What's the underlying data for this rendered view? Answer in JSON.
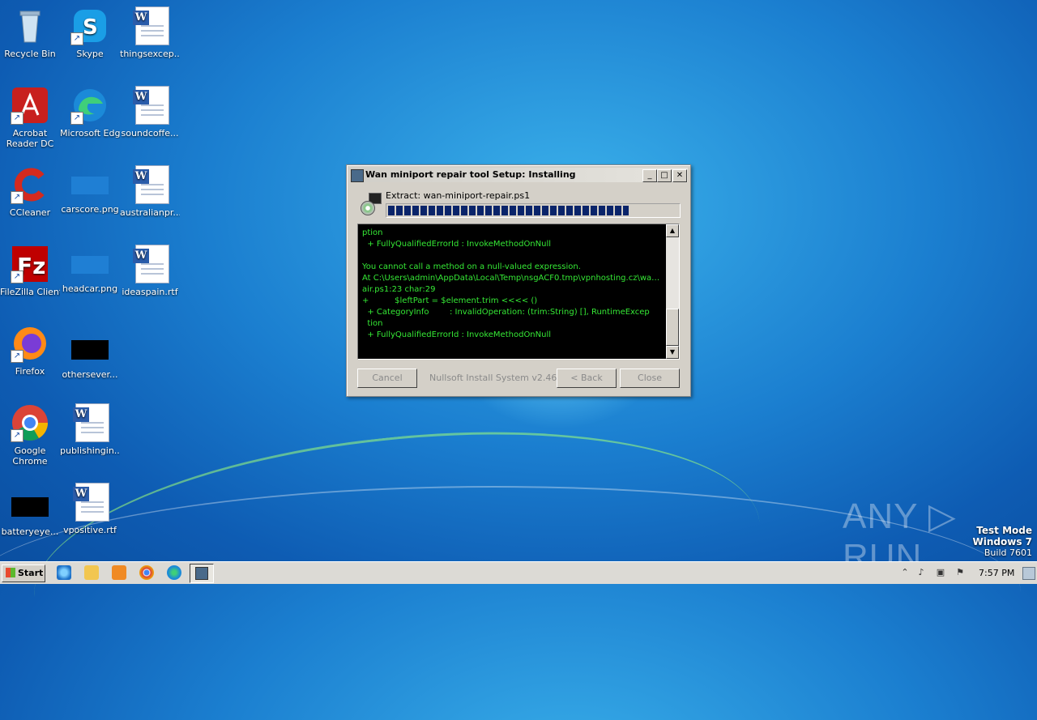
{
  "desktop": {
    "icons": [
      {
        "label": "Recycle Bin"
      },
      {
        "label": "Skype"
      },
      {
        "label": "thingsexcep..."
      },
      {
        "label": "Acrobat Reader DC"
      },
      {
        "label": "Microsoft Edge"
      },
      {
        "label": "soundcoffe..."
      },
      {
        "label": "CCleaner"
      },
      {
        "label": "carscore.png"
      },
      {
        "label": "australianpr..."
      },
      {
        "label": "FileZilla Client"
      },
      {
        "label": "headcar.png"
      },
      {
        "label": "ideaspain.rtf"
      },
      {
        "label": "Firefox"
      },
      {
        "label": "othersever..."
      },
      {
        "label": "Google Chrome"
      },
      {
        "label": "publishingin..."
      },
      {
        "label": "batteryeye..."
      },
      {
        "label": "vpositive.rtf"
      }
    ]
  },
  "installer": {
    "title": "Wan miniport repair tool Setup: Installing",
    "extract_text": "Extract: wan-miniport-repair.ps1",
    "progress": 0.82,
    "log_lines": [
      "ption",
      "  + FullyQualifiedErrorId : InvokeMethodOnNull",
      "",
      "You cannot call a method on a null-valued expression.",
      "At C:\\Users\\admin\\AppData\\Local\\Temp\\nsgACF0.tmp\\vpnhosting.cz\\wan-miniport-rep",
      "air.ps1:23 char:29",
      "+          $leftPart = $element.trim <<<< ()",
      "  + CategoryInfo        : InvalidOperation: (trim:String) [], RuntimeExcep",
      "  tion",
      "  + FullyQualifiedErrorId : InvokeMethodOnNull"
    ],
    "buttons": {
      "cancel": "Cancel",
      "back": "< Back",
      "close": "Close"
    },
    "branding": "Nullsoft Install System v2.46"
  },
  "watermark": {
    "brand": "ANY ▷ RUN",
    "test_mode": "Test Mode",
    "os": "Windows 7",
    "build": "Build 7601"
  },
  "taskbar": {
    "start_label": "Start",
    "clock": "7:57 PM"
  },
  "colors": {
    "log_text": "#35e835",
    "progress": "#0a246a"
  }
}
